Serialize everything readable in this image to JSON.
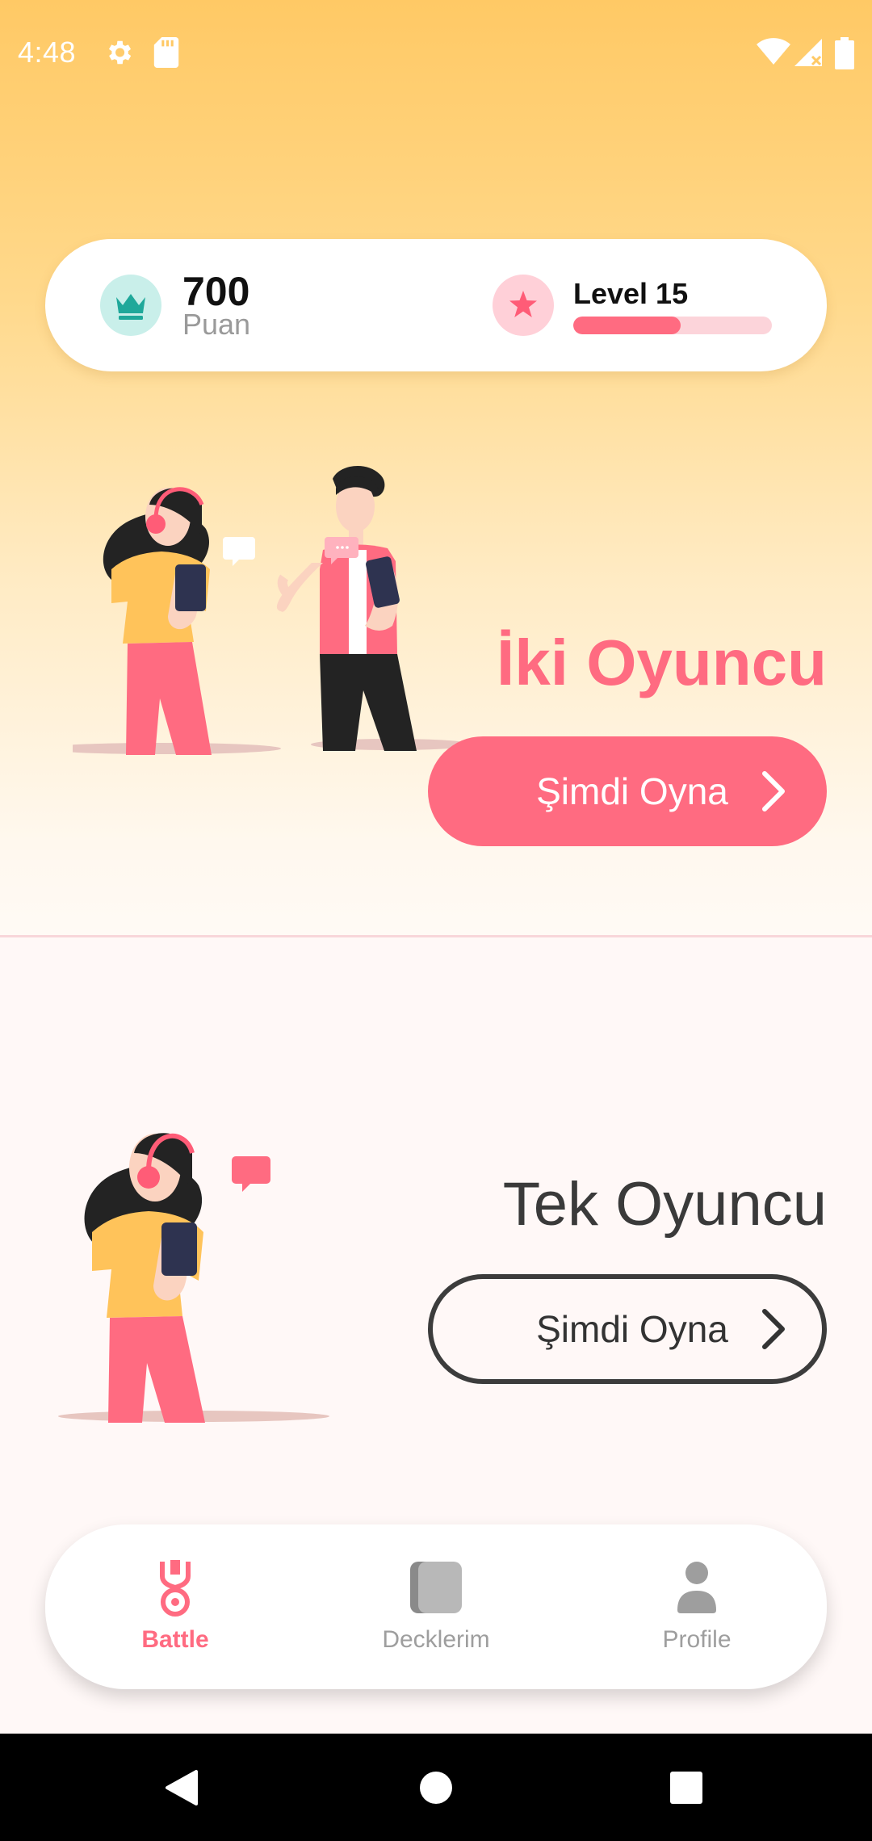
{
  "status_bar": {
    "time": "4:48",
    "icons": [
      "settings-gear-icon",
      "sd-card-icon",
      "wifi-icon",
      "cell-signal-icon",
      "battery-icon"
    ]
  },
  "stats": {
    "points_value": "700",
    "points_label": "Puan",
    "points_icon": "crown-icon",
    "level_label": "Level 15",
    "level_icon": "star-icon",
    "level_progress": 0.54
  },
  "two_player": {
    "title": "İki Oyuncu",
    "button_label": "Şimdi Oyna"
  },
  "single_player": {
    "title": "Tek Oyuncu",
    "button_label": "Şimdi Oyna"
  },
  "bottom_nav": {
    "items": [
      {
        "label": "Battle",
        "icon": "medal-icon",
        "active": true
      },
      {
        "label": "Decklerim",
        "icon": "cards-icon",
        "active": false
      },
      {
        "label": "Profile",
        "icon": "person-icon",
        "active": false
      }
    ]
  },
  "colors": {
    "accent": "#FF6B81",
    "gradient_top": "#FFC965",
    "teal": "#1FA89A",
    "inactive": "#9E9E9E"
  }
}
